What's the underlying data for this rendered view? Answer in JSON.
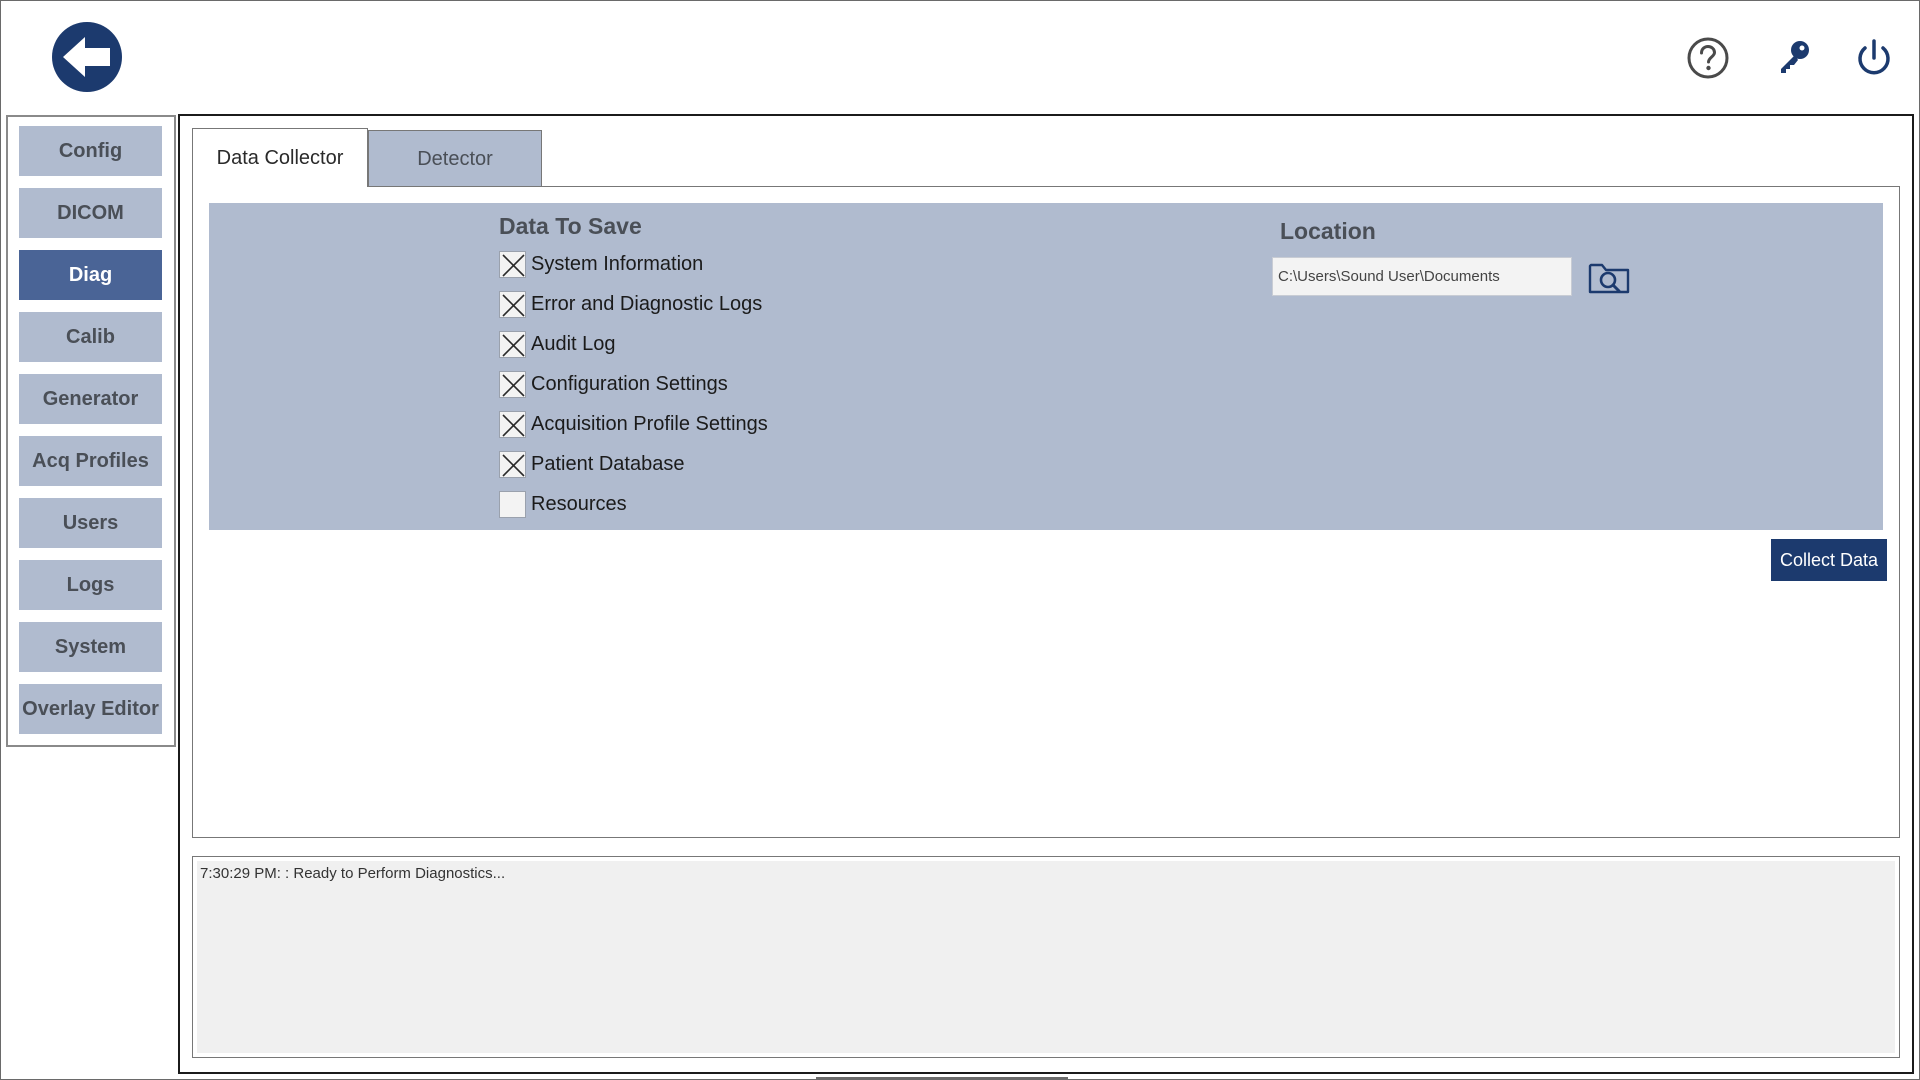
{
  "header": {
    "back_icon": "back-arrow-icon",
    "icons": [
      "help-icon",
      "key-icon",
      "power-icon"
    ]
  },
  "sidebar": {
    "items": [
      {
        "label": "Config",
        "active": false
      },
      {
        "label": "DICOM",
        "active": false
      },
      {
        "label": "Diag",
        "active": true
      },
      {
        "label": "Calib",
        "active": false
      },
      {
        "label": "Generator",
        "active": false
      },
      {
        "label": "Acq Profiles",
        "active": false
      },
      {
        "label": "Users",
        "active": false
      },
      {
        "label": "Logs",
        "active": false
      },
      {
        "label": "System",
        "active": false
      },
      {
        "label": "Overlay Editor",
        "active": false
      }
    ]
  },
  "tabs": [
    {
      "label": "Data Collector",
      "active": true
    },
    {
      "label": "Detector",
      "active": false
    }
  ],
  "data_collector": {
    "data_to_save_title": "Data To Save",
    "options": [
      {
        "label": "System Information",
        "checked": true
      },
      {
        "label": "Error and Diagnostic Logs",
        "checked": true
      },
      {
        "label": "Audit Log",
        "checked": true
      },
      {
        "label": "Configuration Settings",
        "checked": true
      },
      {
        "label": "Acquisition Profile Settings",
        "checked": true
      },
      {
        "label": "Patient Database",
        "checked": true
      },
      {
        "label": "Resources",
        "checked": false
      }
    ],
    "location_title": "Location",
    "location_value": "C:\\Users\\Sound User\\Documents",
    "browse_icon": "folder-search-icon",
    "collect_button": "Collect Data"
  },
  "status_log": {
    "line": "7:30:29 PM: : Ready to Perform Diagnostics..."
  },
  "colors": {
    "accent_dark": "#1c3a6e",
    "nav_bg": "#b0bbcf",
    "nav_active": "#4a6496",
    "panel_bg": "#b0bbcf"
  }
}
